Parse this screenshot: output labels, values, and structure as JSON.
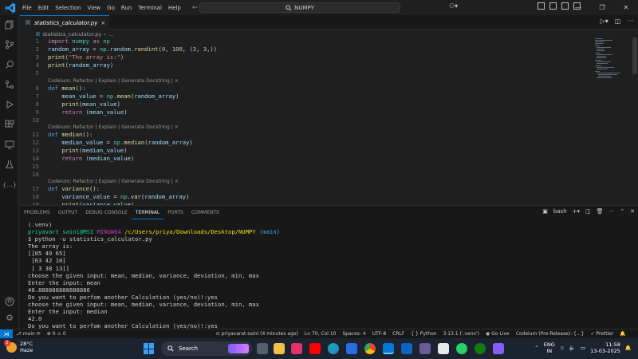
{
  "titlebar": {
    "menu": [
      "File",
      "Edit",
      "Selection",
      "View",
      "Go",
      "Run",
      "Terminal",
      "Help"
    ],
    "search_text": "NUMPY"
  },
  "tab": {
    "filename": "statistics_calculator.py"
  },
  "breadcrumb": {
    "file": "statistics_calculator.py",
    "symbol": "..."
  },
  "editor": {
    "codelens": "Codeium: Refactor | Explain | Generate Docstring | ×"
  },
  "panel": {
    "tabs": [
      "PROBLEMS",
      "OUTPUT",
      "DEBUG CONSOLE",
      "TERMINAL",
      "PORTS",
      "COMMENTS"
    ],
    "active_tab": "TERMINAL",
    "shell": "bash"
  },
  "terminal": {
    "venv": "(.venv)",
    "prompt_user": "priyavart saini@MSI",
    "prompt_env": "MINGW64",
    "prompt_path": "/c/Users/priya/Downloads/Desktop/NUMPY",
    "prompt_branch": "(main)",
    "command": "$ python -u statistics_calculator.py",
    "output": [
      "The array is:",
      "[[85 49 65]",
      " [63 42 10]",
      " [ 3 38 13]]",
      "choose the given input: mean, median, variance, deviation, min, max",
      "Enter the input: mean",
      "40.888888888888886",
      "Do you want to perfom another Calculation (yes/no)!:yes",
      "choose the given input: mean, median, variance, deviation, min, max",
      "Enter the input: median",
      "42.0",
      "Do you want to perfom another Calculation (yes/no)!:yes"
    ]
  },
  "statusbar": {
    "branch": "main",
    "errors": "0",
    "warnings": "0",
    "blame": "priyavarat saini (4 minutes ago)",
    "position": "Ln 70, Col 10",
    "spaces": "Spaces: 4",
    "encoding": "UTF-8",
    "eol": "CRLF",
    "language": "Python",
    "interpreter": "3.13.1 ('.venv')",
    "golive": "Go Live",
    "codeium": "Codeium (Pre-Release): {...}",
    "prettier": "Prettier"
  },
  "taskbar": {
    "temperature": "28°C",
    "weather": "Haze",
    "search_label": "Search",
    "lang_top": "ENG",
    "lang_bottom": "IN",
    "time": "11:58",
    "date": "13-03-2025",
    "notification_count": "1"
  },
  "colors": {
    "accent": "#0078d4",
    "editor_bg": "#1f1f1f",
    "panel_bg": "#181818",
    "taskbar_bg": "#1c2330"
  }
}
